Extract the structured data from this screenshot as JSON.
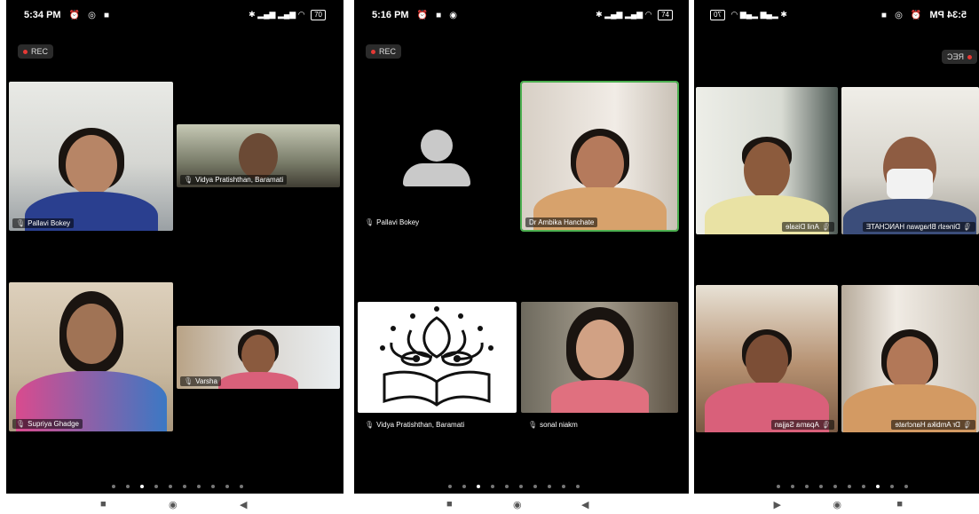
{
  "phones": [
    {
      "time": "5:34 PM",
      "battery": "70",
      "rec": "REC",
      "participants": [
        "Pallavi Bokey",
        "Vidya Pratishthan, Baramati",
        "Supriya Ghadge",
        "Varsha"
      ],
      "active_page": 2,
      "page_count": 10
    },
    {
      "time": "5:16 PM",
      "battery": "74",
      "rec": "REC",
      "participants": [
        "Pallavi Bokey",
        "Dr Ambika Hanchate",
        "Vidya Pratishthan, Baramati",
        "sonal niakm"
      ],
      "active_page": 2,
      "page_count": 10
    },
    {
      "time": "5:34 PM",
      "battery": "70",
      "rec": "REC",
      "participants": [
        "Anil Disale",
        "Dinesh Bhagwan HANCHATE",
        "Aparna Sajjan",
        "Dr Ambika Hanchate"
      ],
      "active_page": 2,
      "page_count": 10
    }
  ],
  "icons": {
    "mic": "mic-muted-icon",
    "recent": "recent-apps-icon",
    "home": "home-icon",
    "back": "back-icon"
  },
  "colors": {
    "rec_dot": "#e53935",
    "active_speaker": "#4caf50"
  }
}
